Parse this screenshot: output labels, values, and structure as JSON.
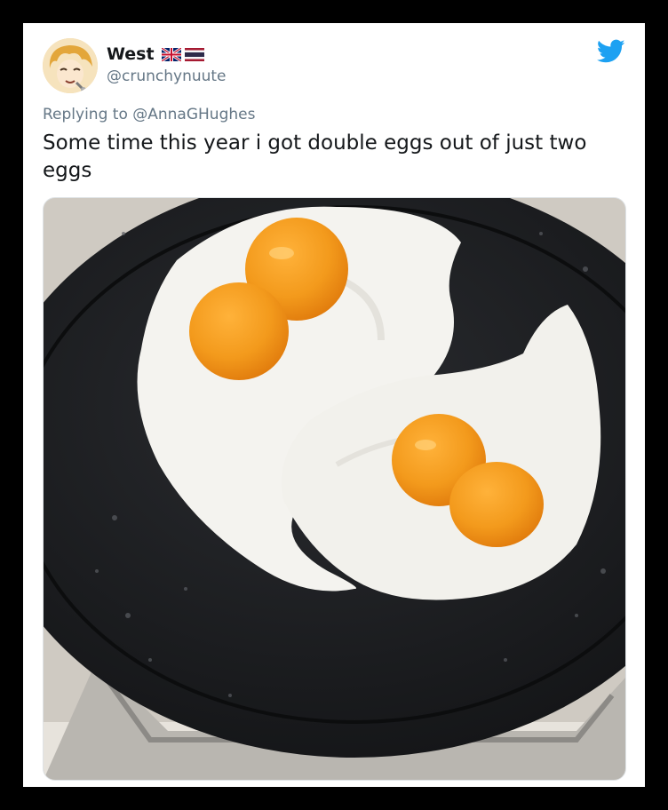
{
  "tweet": {
    "display_name": "West",
    "handle": "@crunchynuute",
    "reply_prefix": "Replying to ",
    "reply_to": "@AnnaGHughes",
    "text": "Some time this year i got double eggs out of just two eggs"
  },
  "icons": {
    "platform": "twitter-bird-icon",
    "flags": [
      "uk-flag-icon",
      "thai-flag-icon"
    ]
  },
  "colors": {
    "twitter_blue": "#1da1f2",
    "text": "#14171a",
    "secondary": "#657786",
    "yolk": "#f39a1c"
  },
  "media": {
    "description_kind": "photo"
  }
}
